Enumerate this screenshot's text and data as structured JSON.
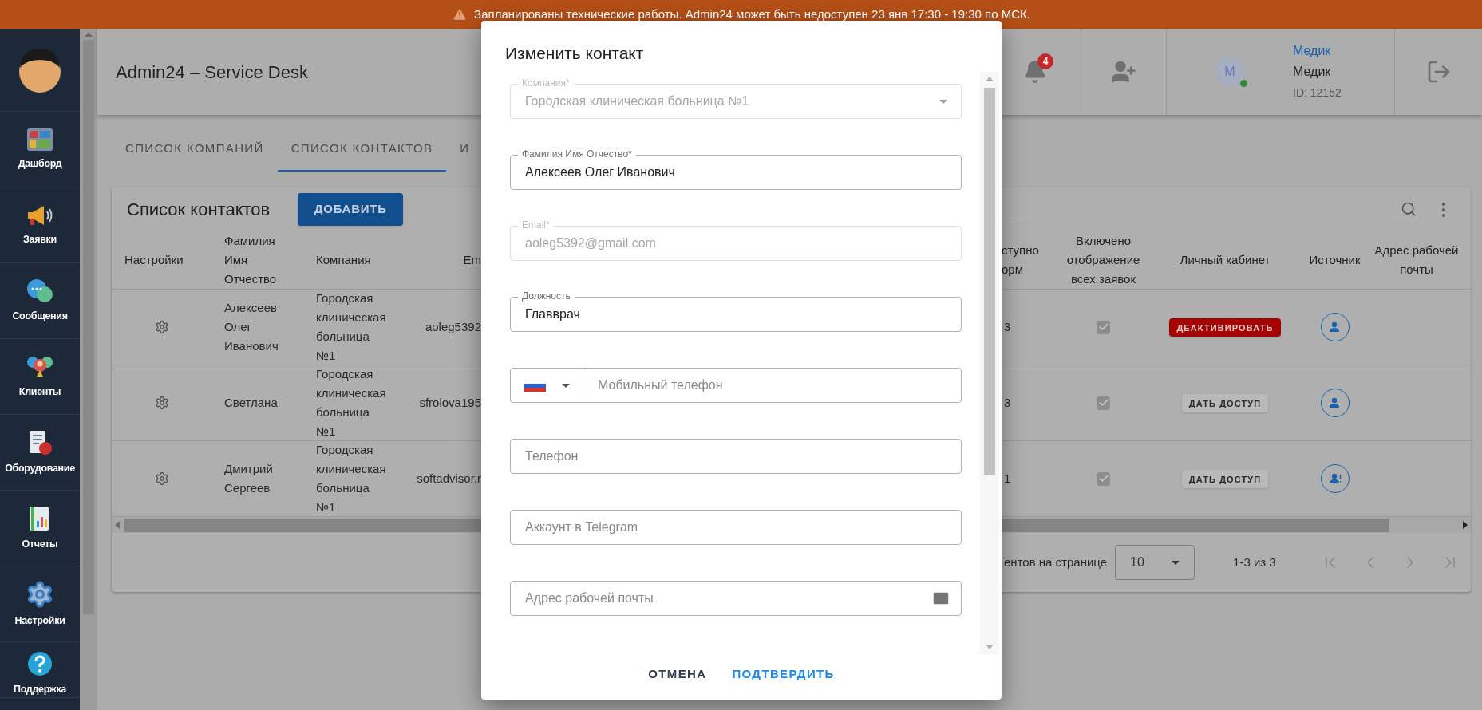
{
  "banner": {
    "text": "Запланированы технические работы. Admin24 может быть недоступен 23 янв 17:30 - 19:30 по МСК."
  },
  "sidebar": {
    "items": [
      {
        "label": "Дашборд"
      },
      {
        "label": "Заявки"
      },
      {
        "label": "Сообщения"
      },
      {
        "label": "Клиенты"
      },
      {
        "label": "Оборудование"
      },
      {
        "label": "Отчеты"
      },
      {
        "label": "Настройки"
      },
      {
        "label": "Поддержка"
      }
    ]
  },
  "header": {
    "title": "Admin24 – Service Desk",
    "notifications": {
      "count": "4"
    },
    "user": {
      "initial": "M",
      "online": true,
      "link": "Медик",
      "name": "Медик",
      "id": "ID: 12152"
    }
  },
  "tabs": [
    {
      "label": "СПИСОК КОМПАНИЙ",
      "selected": false
    },
    {
      "label": "СПИСОК КОНТАКТОВ",
      "selected": true
    },
    {
      "label": "И",
      "selected": false
    }
  ],
  "contacts": {
    "title": "Список контактов",
    "add_button": "ДОБАВИТЬ",
    "columns": [
      "Настройки",
      "Фамилия Имя Отчество",
      "Компания",
      "Em",
      "ступно орм",
      "Включено отображение всех заявок",
      "Личный кабинет",
      "Источник",
      "Адрес рабочей почты"
    ],
    "rows": [
      {
        "name": "Алексеев Олег Иванович",
        "company": "Городская клиническая больница №1",
        "email": "aoleg5392",
        "access": "3",
        "all_requests": true,
        "cabinet": {
          "kind": "deactivate",
          "label": "ДЕАКТИВИРОВАТЬ"
        },
        "source": {
          "kind": "contact"
        }
      },
      {
        "name": "Светлана",
        "company": "Городская клиническая больница №1",
        "email": "sfrolova195",
        "access": "3",
        "all_requests": true,
        "cabinet": {
          "kind": "grant",
          "label": "ДАТЬ ДОСТУП"
        },
        "source": {
          "kind": "contact"
        }
      },
      {
        "name": "Дмитрий Сергеев",
        "company": "Городская клиническая больница №1",
        "email": "softadvisor.r",
        "access": "1",
        "all_requests": true,
        "cabinet": {
          "kind": "grant",
          "label": "ДАТЬ ДОСТУП"
        },
        "source": {
          "kind": "contact_alert"
        }
      }
    ]
  },
  "pagination": {
    "rows_label": "ентов на странице",
    "page_size": "10",
    "range": "1-3 из 3",
    "nav": [
      {
        "kind": "first",
        "disabled": true
      },
      {
        "kind": "prev",
        "disabled": true
      },
      {
        "kind": "next",
        "disabled": true
      },
      {
        "kind": "last",
        "disabled": true
      }
    ]
  },
  "dialog": {
    "title": "Изменить контакт",
    "fields": [
      {
        "kind": "select",
        "label": "Компания*",
        "value": "Городская клиническая больница №1",
        "disabled": true
      },
      {
        "kind": "text",
        "label": "Фамилия Имя Отчество*",
        "value": "Алексеев Олег Иванович",
        "disabled": false
      },
      {
        "kind": "text",
        "label": "Email*",
        "value": "aoleg5392@gmail.com",
        "disabled": true
      },
      {
        "kind": "text",
        "label": "Должность",
        "value": "Главврач",
        "disabled": false
      },
      {
        "kind": "phone",
        "placeholder": "Мобильный телефон",
        "disabled": false
      },
      {
        "kind": "text",
        "placeholder": "Телефон",
        "disabled": false
      },
      {
        "kind": "text",
        "placeholder": "Аккаунт в Telegram",
        "disabled": false
      },
      {
        "kind": "email",
        "placeholder": "Адрес рабочей почты",
        "disabled": false
      }
    ],
    "buttons": [
      {
        "kind": "secondary",
        "label": "ОТМЕНА"
      },
      {
        "kind": "primary",
        "label": "ПОДТВЕРДИТЬ"
      }
    ]
  }
}
